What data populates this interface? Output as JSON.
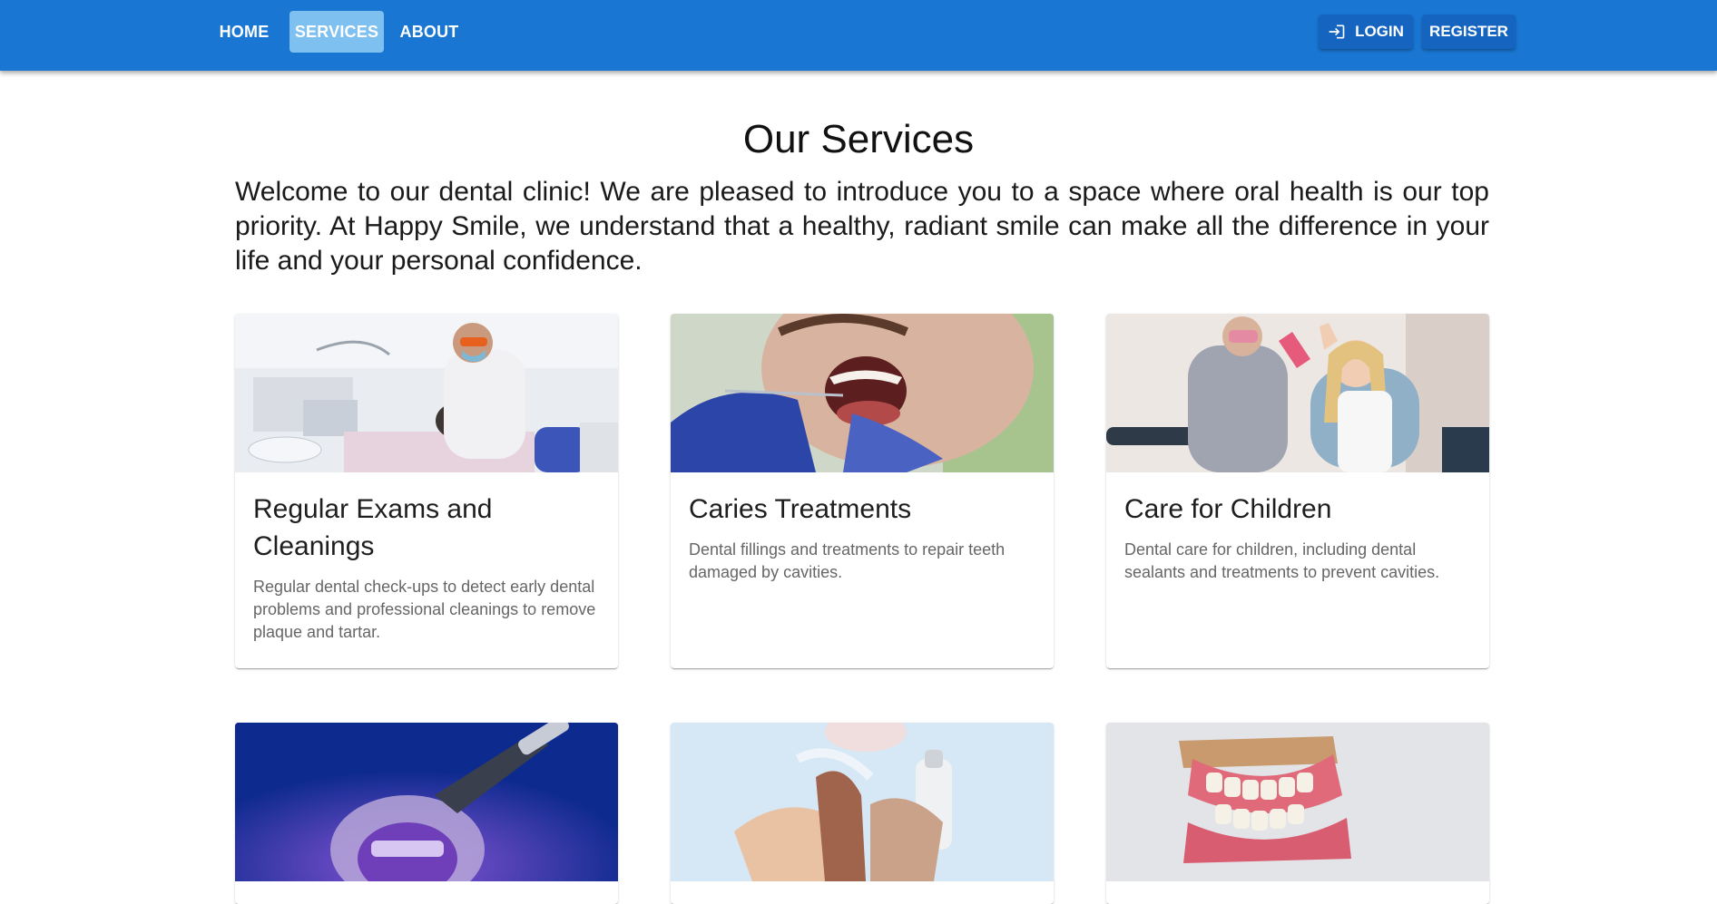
{
  "nav": {
    "items": [
      {
        "label": "HOME"
      },
      {
        "label": "SERVICES",
        "active": true
      },
      {
        "label": "ABOUT"
      }
    ],
    "login_label": "LOGIN",
    "register_label": "REGISTER"
  },
  "page": {
    "title": "Our Services",
    "intro": "Welcome to our dental clinic! We are pleased to introduce you to a space where oral health is our top priority. At Happy Smile, we understand that a healthy, radiant smile can make all the difference in your life and your personal confidence."
  },
  "services": [
    {
      "title": "Regular Exams and Cleanings",
      "description": "Regular dental check-ups to detect early dental problems and professional cleanings to remove plaque and tartar.",
      "image_subject": "dentist examining patient in dental chair"
    },
    {
      "title": "Caries Treatments",
      "description": "Dental fillings and treatments to repair teeth damaged by cavities.",
      "image_subject": "patient with open mouth during dental treatment"
    },
    {
      "title": "Care for Children",
      "description": "Dental care for children, including dental sealants and treatments to prevent cavities.",
      "image_subject": "child giving high five to dentist"
    },
    {
      "image_subject": "braces with curing light"
    },
    {
      "image_subject": "hands holding clear aligners"
    },
    {
      "image_subject": "denture model"
    }
  ],
  "colors": {
    "appbar": "#1976d2",
    "active_nav": "#7ec0ef",
    "auth_button": "#1565c0"
  }
}
